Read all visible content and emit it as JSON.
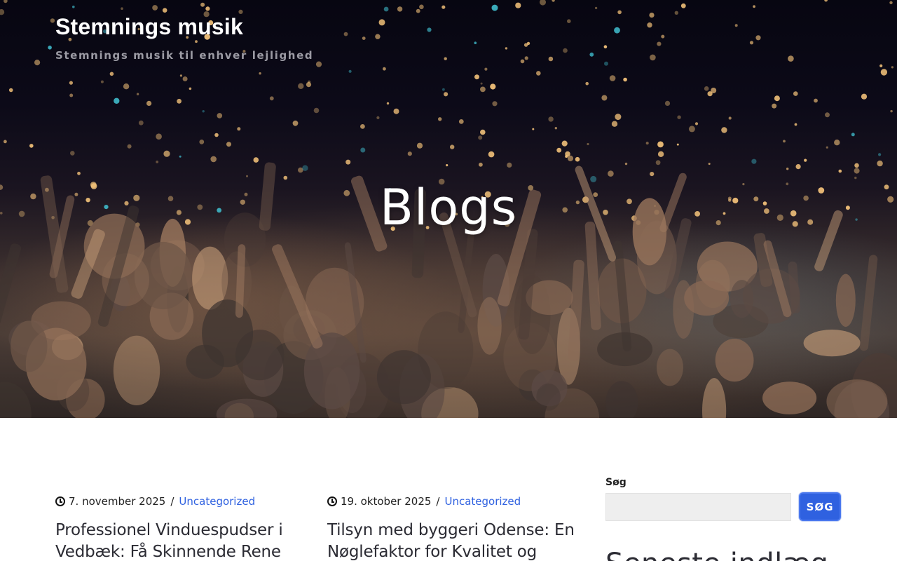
{
  "site": {
    "title": "Stemnings musik",
    "tagline": "Stemnings musik til enhver lejlighed"
  },
  "hero": {
    "title": "Blogs"
  },
  "posts": [
    {
      "date": "7. november 2025",
      "separator": "/",
      "category": "Uncategorized",
      "title_line1": "Professionel Vinduespudser i",
      "title_line2": "Vedbæk: Få Skinnende Rene"
    },
    {
      "date": "19. oktober 2025",
      "separator": "/",
      "category": "Uncategorized",
      "title_line1": "Tilsyn med byggeri Odense: En",
      "title_line2": "Nøglefaktor for Kvalitet og"
    }
  ],
  "sidebar": {
    "search_label": "Søg",
    "search_placeholder": "",
    "search_button": "SØG",
    "heading": "Seneste indlæg"
  },
  "colors": {
    "accent": "#2f61e0",
    "text": "#2b2b33"
  }
}
